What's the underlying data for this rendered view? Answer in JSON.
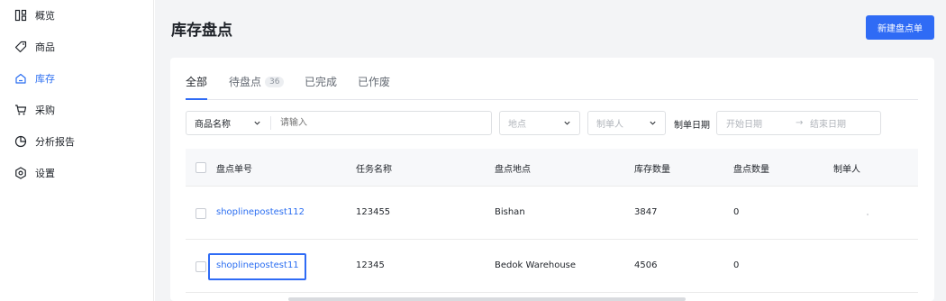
{
  "sidebar": {
    "items": [
      {
        "label": "概览",
        "icon": "overview-icon"
      },
      {
        "label": "商品",
        "icon": "tag-icon"
      },
      {
        "label": "库存",
        "icon": "home-icon",
        "active": true
      },
      {
        "label": "采购",
        "icon": "cart-icon"
      },
      {
        "label": "分析报告",
        "icon": "chart-icon"
      },
      {
        "label": "设置",
        "icon": "settings-icon"
      }
    ]
  },
  "header": {
    "title": "库存盘点",
    "new_button": "新建盘点单"
  },
  "tabs": [
    {
      "label": "全部",
      "active": true
    },
    {
      "label": "待盘点",
      "badge": "36"
    },
    {
      "label": "已完成"
    },
    {
      "label": "已作废"
    }
  ],
  "filters": {
    "field_select": "商品名称",
    "keyword_placeholder": "请输入",
    "location_placeholder": "地点",
    "creator_placeholder": "制单人",
    "date_label": "制单日期",
    "start_date_placeholder": "开始日期",
    "date_separator": "→",
    "end_date_placeholder": "结束日期"
  },
  "table": {
    "columns": [
      "盘点单号",
      "任务名称",
      "盘点地点",
      "库存数量",
      "盘点数量",
      "制单人"
    ],
    "rows": [
      {
        "id": "shoplinepostest112",
        "task": "123455",
        "location": "Bishan",
        "stock": "3847",
        "counted": "0",
        "creator": ""
      },
      {
        "id": "shoplinepostest11",
        "task": "12345",
        "location": "Bedok Warehouse",
        "stock": "4506",
        "counted": "0",
        "creator": ""
      }
    ]
  },
  "colors": {
    "accent": "#2f6bf5",
    "link": "#2b6ef1",
    "background": "#f3f4f6"
  }
}
